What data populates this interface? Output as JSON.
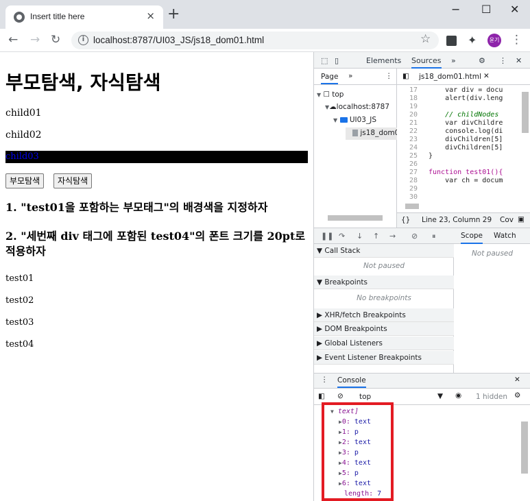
{
  "browser": {
    "tab_title": "Insert title here",
    "tab_close": "×",
    "new_tab": "+",
    "minimize": "−",
    "maximize": "☐",
    "close": "✕",
    "url": "localhost:8787/UI03_JS/js18_dom01.html",
    "avatar_text": "윤기"
  },
  "page": {
    "heading": "부모탐색, 자식탐색",
    "children": [
      "child01",
      "child02",
      "child03"
    ],
    "buttons": [
      "부모탐색",
      "자식탐색"
    ],
    "task1": "1. \"test01을 포함하는 부모태그\"의 배경색을 지정하자",
    "task2": "2. \"세번째 div 태그에 포함된 test04\"의 폰트 크기를 20pt로 적용하자",
    "tests": [
      "test01",
      "test02",
      "test03",
      "test04"
    ]
  },
  "devtools": {
    "tabs": [
      "Elements",
      "Sources"
    ],
    "more": "»",
    "nav_tab": "Page",
    "tree": [
      "top",
      "localhost:8787",
      "UI03_JS",
      "js18_dom0"
    ],
    "file_tab": "js18_dom01.html",
    "code_lines": [
      {
        "n": "17",
        "t": "    var div = docu"
      },
      {
        "n": "18",
        "t": "    alert(div.leng"
      },
      {
        "n": "19",
        "t": ""
      },
      {
        "n": "20",
        "t": "    // childNodes"
      },
      {
        "n": "21",
        "t": "    var divChildre"
      },
      {
        "n": "22",
        "t": "    console.log(di"
      },
      {
        "n": "23",
        "t": "    divChildren[5]"
      },
      {
        "n": "24",
        "t": "    divChildren[5]"
      },
      {
        "n": "25",
        "t": "}"
      },
      {
        "n": "26",
        "t": ""
      },
      {
        "n": "27",
        "t": "function test01(){"
      },
      {
        "n": "28",
        "t": "    var ch = docum"
      },
      {
        "n": "29",
        "t": ""
      },
      {
        "n": "30",
        "t": ""
      }
    ],
    "status": "Line 23, Column 29",
    "status_right": "Cov",
    "sections": [
      {
        "title": "Call Stack",
        "body": "Not paused"
      },
      {
        "title": "Breakpoints",
        "body": "No breakpoints"
      },
      {
        "title": "XHR/fetch Breakpoints"
      },
      {
        "title": "DOM Breakpoints"
      },
      {
        "title": "Global Listeners"
      },
      {
        "title": "Event Listener Breakpoints"
      }
    ],
    "scope_tabs": [
      "Scope",
      "Watch"
    ],
    "scope_body": "Not paused",
    "console_title": "Console",
    "console_context": "top",
    "hidden_count": "1 hidden",
    "console_header": "text]",
    "console_items": [
      {
        "k": "0",
        "v": "text"
      },
      {
        "k": "1",
        "v": "p"
      },
      {
        "k": "2",
        "v": "text"
      },
      {
        "k": "3",
        "v": "p"
      },
      {
        "k": "4",
        "v": "text"
      },
      {
        "k": "5",
        "v": "p"
      },
      {
        "k": "6",
        "v": "text"
      }
    ],
    "length_label": "length",
    "length_value": "7"
  }
}
